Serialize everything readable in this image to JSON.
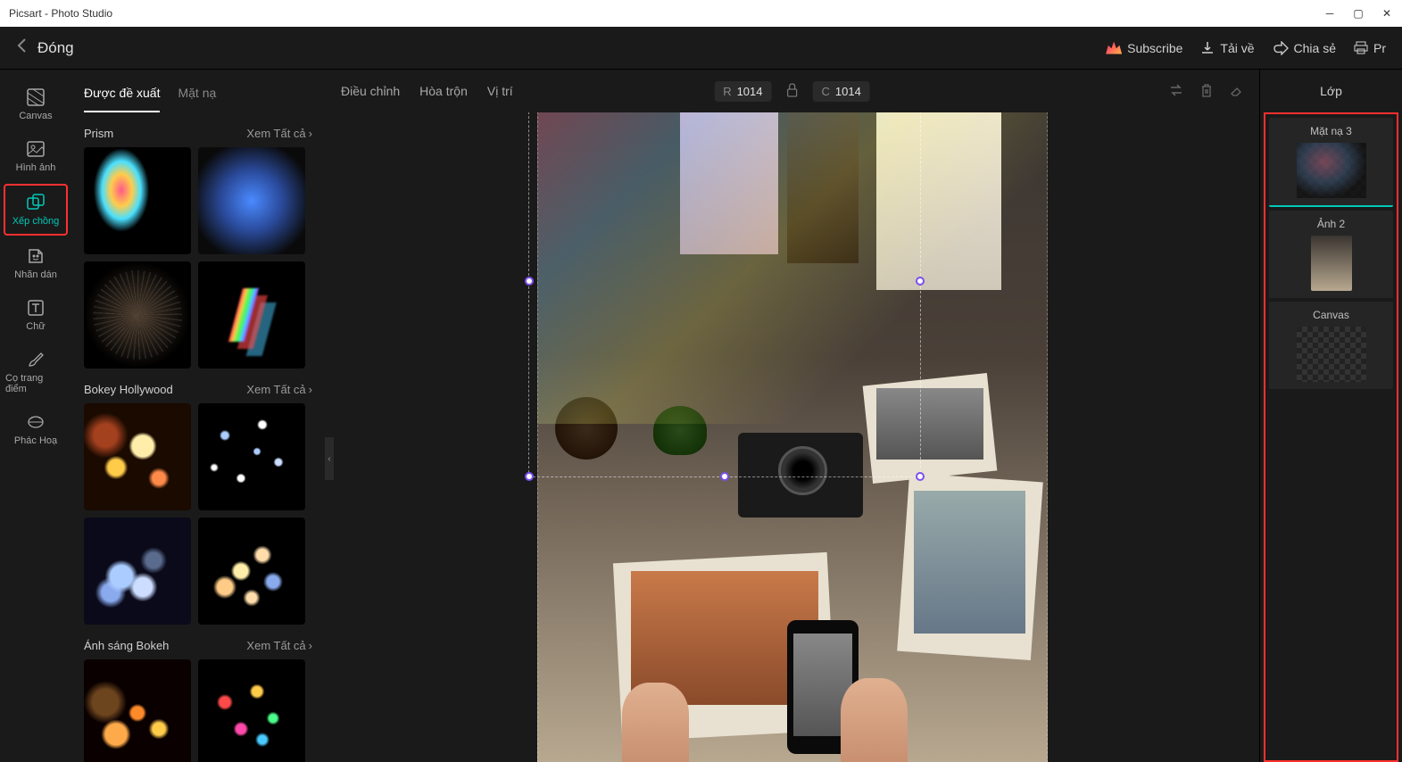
{
  "titlebar": {
    "title": "Picsart - Photo Studio"
  },
  "header": {
    "close": "Đóng",
    "subscribe": "Subscribe",
    "download": "Tải về",
    "share": "Chia sẻ",
    "print": "Pr"
  },
  "toolRail": {
    "canvas": "Canvas",
    "image": "Hình ảnh",
    "overlay": "Xếp chồng",
    "sticker": "Nhãn dán",
    "text": "Chữ",
    "brush": "Cọ trang điểm",
    "sketch": "Phác Hoạ"
  },
  "overlayPanel": {
    "tabSuggested": "Được đề xuất",
    "tabMask": "Mặt nạ",
    "seeAll": "Xem Tất cả",
    "cat1": "Prism",
    "cat2": "Bokey Hollywood",
    "cat3": "Ánh sáng Bokeh"
  },
  "canvasHeader": {
    "adjust": "Điều chỉnh",
    "blend": "Hòa trộn",
    "position": "Vị trí",
    "rLabel": "R",
    "rValue": "1014",
    "cLabel": "C",
    "cValue": "1014"
  },
  "layers": {
    "title": "Lớp",
    "l1": "Mặt nạ 3",
    "l2": "Ảnh 2",
    "l3": "Canvas"
  }
}
